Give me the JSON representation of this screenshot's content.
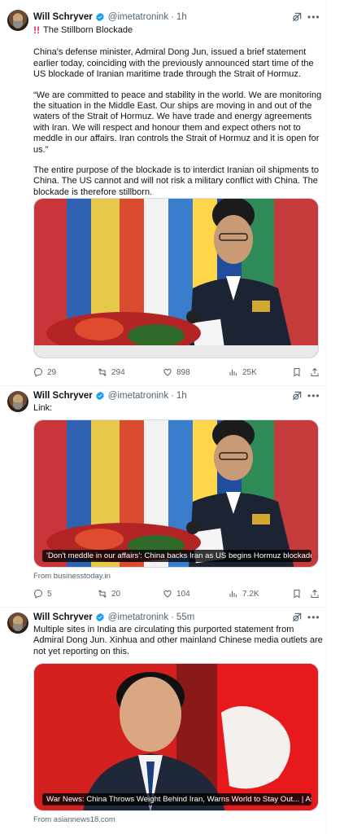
{
  "colors": {
    "verified": "#1d9bf0",
    "text": "#0f1419",
    "secondary": "#536471",
    "border": "#cfd9de"
  },
  "tweets": [
    {
      "author": "Will Schryver",
      "handle": "@imetatronink",
      "time": "1h",
      "title": "The Stillborn Blockade",
      "paragraphs": [
        "China's defense minister, Admiral Dong Jun, issued a brief statement earlier today, coinciding with the previously announced start time of the US blockade of Iranian maritime trade through the Strait of Hormuz.",
        "“We are committed to peace and stability in the world. We are monitoring the situation in the Middle East. Our ships are moving in and out of the waters of the Strait of Hormuz. We have trade and energy agreements with Iran. We will respect and honour them and expect others not to meddle in our affairs. Iran controls the Strait of Hormuz and it is open for us.”",
        "The entire purpose of the blockade is to interdict Iranian oil shipments to China. The US cannot and will not risk a military conflict with China. The blockade is therefore stillborn."
      ],
      "stats": {
        "replies": "29",
        "reposts": "294",
        "likes": "898",
        "views": "25K"
      }
    },
    {
      "author": "Will Schryver",
      "handle": "@imetatronink",
      "time": "1h",
      "text": "Link:",
      "card_title": "'Don't meddle in our affairs': China backs Iran as US begins Hormuz blockade -...",
      "card_source": "From businesstoday.in",
      "stats": {
        "replies": "5",
        "reposts": "20",
        "likes": "104",
        "views": "7.2K"
      }
    },
    {
      "author": "Will Schryver",
      "handle": "@imetatronink",
      "time": "55m",
      "text": "Multiple sites in India are circulating this purported statement from Admiral Dong Jun. Xinhua and other mainland Chinese media outlets are not yet reporting on this.",
      "card_title": "War News: China Throws Weight Behind Iran, Warns World to Stay Out... | Asia...",
      "card_source": "From asiannews18.com"
    }
  ]
}
